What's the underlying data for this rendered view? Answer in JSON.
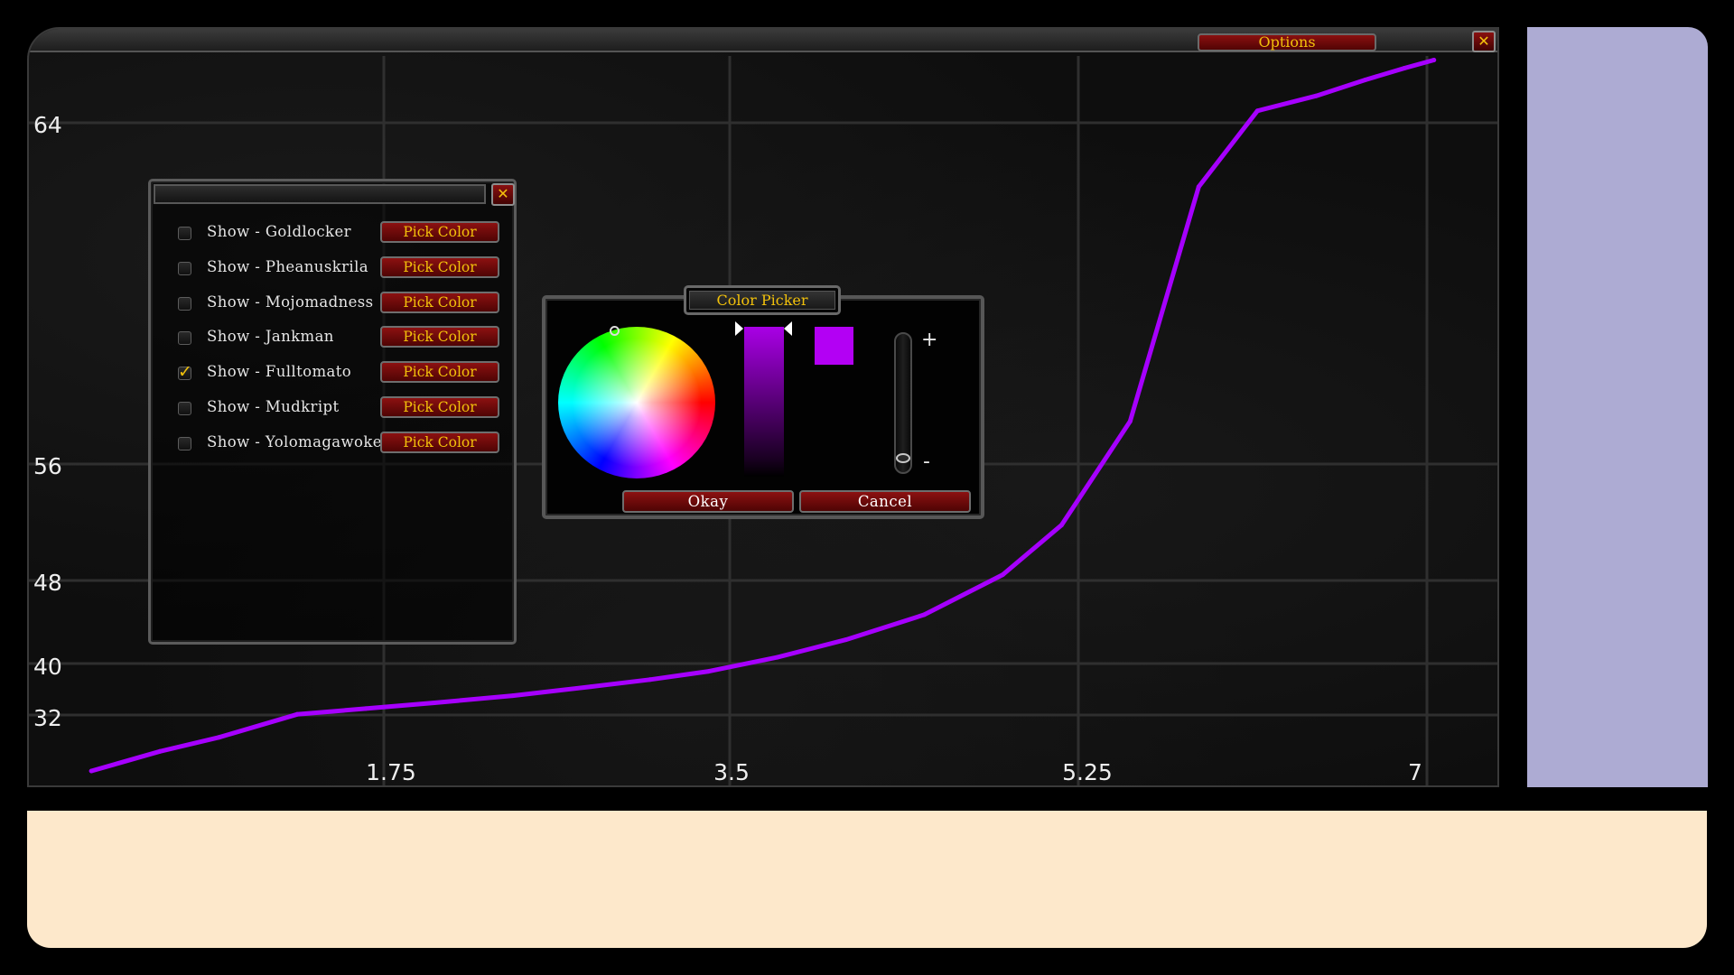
{
  "graph_window": {
    "options_label": "Options",
    "close_glyph": "✕"
  },
  "chart_data": {
    "type": "line",
    "x_ticks": [
      "1.75",
      "3.5",
      "5.25",
      "7"
    ],
    "y_ticks": [
      "64",
      "56",
      "48",
      "40",
      "32"
    ],
    "xlim": [
      0.15,
      7.55
    ],
    "series": [
      {
        "color": "#a600ff",
        "x": [
          0.35,
          0.7,
          1.0,
          1.4,
          1.75,
          2.1,
          2.5,
          2.9,
          3.2,
          3.5,
          3.85,
          4.2,
          4.6,
          5.0,
          5.3,
          5.65,
          6.0,
          6.3,
          6.6,
          6.85,
          7.05,
          7.2
        ],
        "y": [
          30.0,
          30.7,
          31.2,
          32.1,
          33.0,
          33.9,
          35.0,
          36.4,
          37.5,
          38.8,
          40.6,
          42.3,
          44.7,
          48.4,
          51.8,
          57.0,
          62.5,
          69.3,
          75.9,
          83.0,
          88.2,
          91.8
        ]
      }
    ]
  },
  "player_window": {
    "close_glyph": "✕",
    "rows": [
      {
        "label": "Show - Goldlocker",
        "button": "Pick Color",
        "checked": false
      },
      {
        "label": "Show - Pheanuskrila",
        "button": "Pick Color",
        "checked": false
      },
      {
        "label": "Show - Mojomadness",
        "button": "Pick Color",
        "checked": false
      },
      {
        "label": "Show - Jankman",
        "button": "Pick Color",
        "checked": false
      },
      {
        "label": "Show - Fulltomato",
        "button": "Pick Color",
        "checked": true
      },
      {
        "label": "Show - Mudkript",
        "button": "Pick Color",
        "checked": false
      },
      {
        "label": "Show - Yolomagawoke",
        "button": "Pick Color",
        "checked": false
      }
    ]
  },
  "color_picker": {
    "title": "Color Picker",
    "selected_color": "#b300f4",
    "plus_label": "+",
    "minus_label": "-",
    "okay_label": "Okay",
    "cancel_label": "Cancel"
  },
  "colors": {
    "side_panel": "#adabd3",
    "bottom_panel": "#fde8cb",
    "button_text": "#f2c10b"
  }
}
